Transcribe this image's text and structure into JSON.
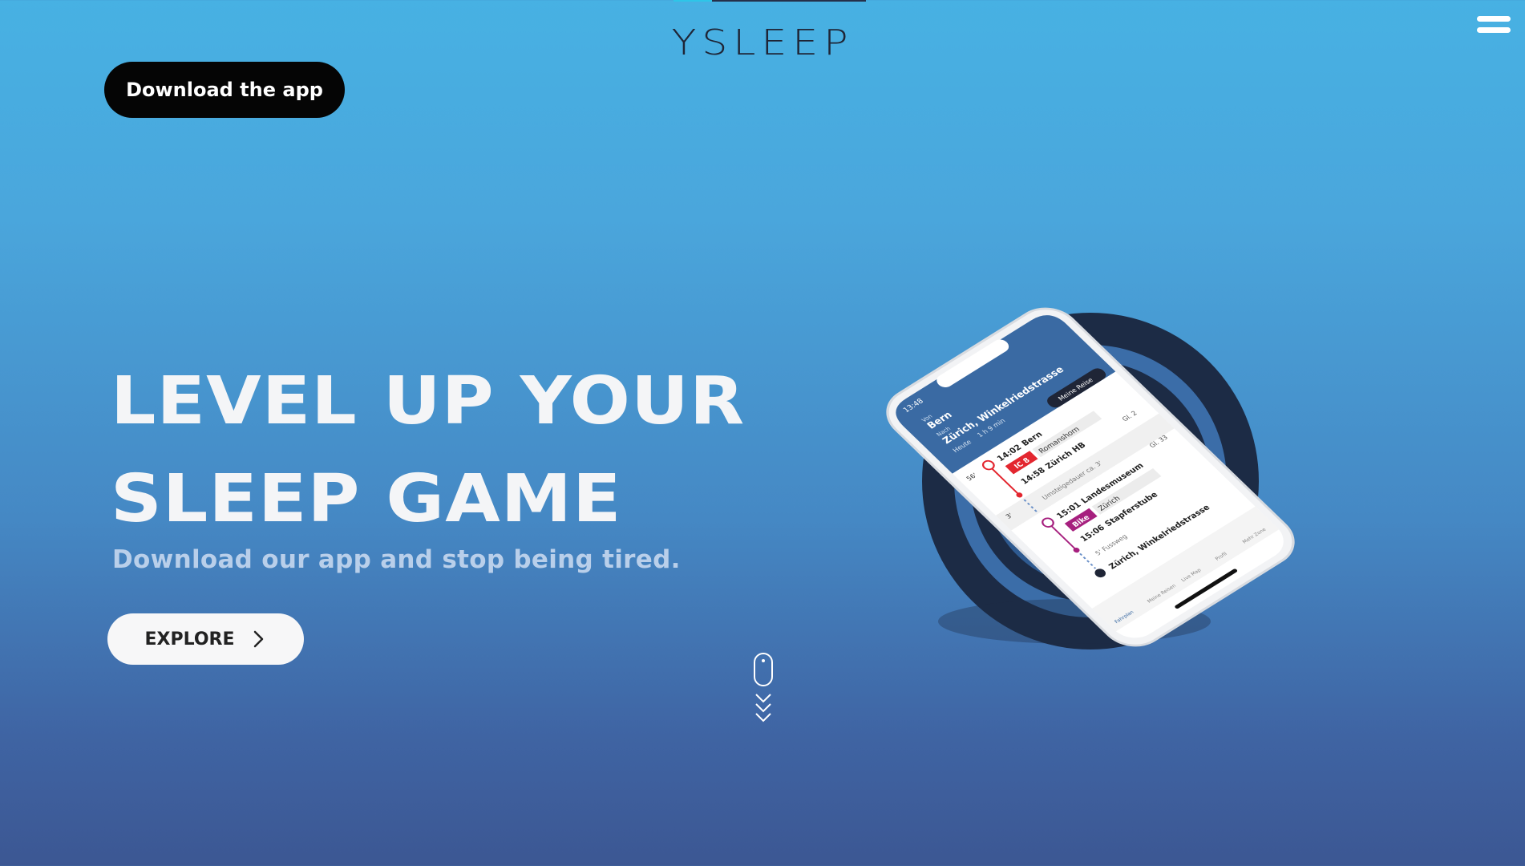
{
  "brand": {
    "logo_text": "YSLEEP"
  },
  "header": {
    "download_button_label": "Download the app",
    "menu_icon": "hamburger-menu-icon"
  },
  "hero": {
    "title_line_1": "LEVEL UP YOUR",
    "title_line_2": "SLEEP GAME",
    "subtitle": "Download our app and stop being tired.",
    "explore_button_label": "EXPLORE",
    "explore_icon": "chevron-right-icon"
  },
  "scroll_indicator": {
    "icon": "mouse-scroll-icon"
  },
  "phone_screen": {
    "time": "13:48",
    "from_label": "Von",
    "from": "Bern",
    "to_label": "Nach",
    "to": "Zürich, Winkelriedstrasse",
    "date": "Heute",
    "duration": "1 h 9 min",
    "my_trip_button": "Meine Reise",
    "leg1_minutes": "56'",
    "leg1_dep_time": "14:02",
    "leg1_dep_place": "Bern",
    "leg1_train": "IC 8",
    "leg1_direction": "Romanshorn",
    "leg1_arr_time": "14:58",
    "leg1_arr_place": "Zürich HB",
    "leg1_track": "Gl. 2",
    "transfer_minutes": "3'",
    "transfer_note": "Umsteigedauer ca. 3'",
    "transfer_track": "Gl. 33",
    "leg2_dep_time": "15:01",
    "leg2_dep_place": "Landesmuseum",
    "leg2_mode": "Bike",
    "leg2_direction": "Zürich",
    "leg2_arr_time": "15:06",
    "leg2_arr_place": "Stapferstube",
    "walk_note": "5' Fussweg",
    "destination": "Zürich, Winkelriedstrasse",
    "nav_items": [
      "Fahrplan",
      "Meine Reisen",
      "Live Map",
      "Profil",
      "Mehr Zone"
    ]
  },
  "colors": {
    "background_top": "#47b1e3",
    "background_bottom": "#3c5793",
    "hero_title": "#f4f5f7",
    "hero_subtitle": "#b9cfea",
    "download_button_bg": "#050505",
    "explore_button_bg": "#f7f7f8",
    "ring_dark": "#1c2b45",
    "ring_mid": "#3b6da8",
    "phone_header": "#3a6aa3",
    "ic_badge": "#e3262f",
    "bike_badge": "#a61f7e"
  }
}
